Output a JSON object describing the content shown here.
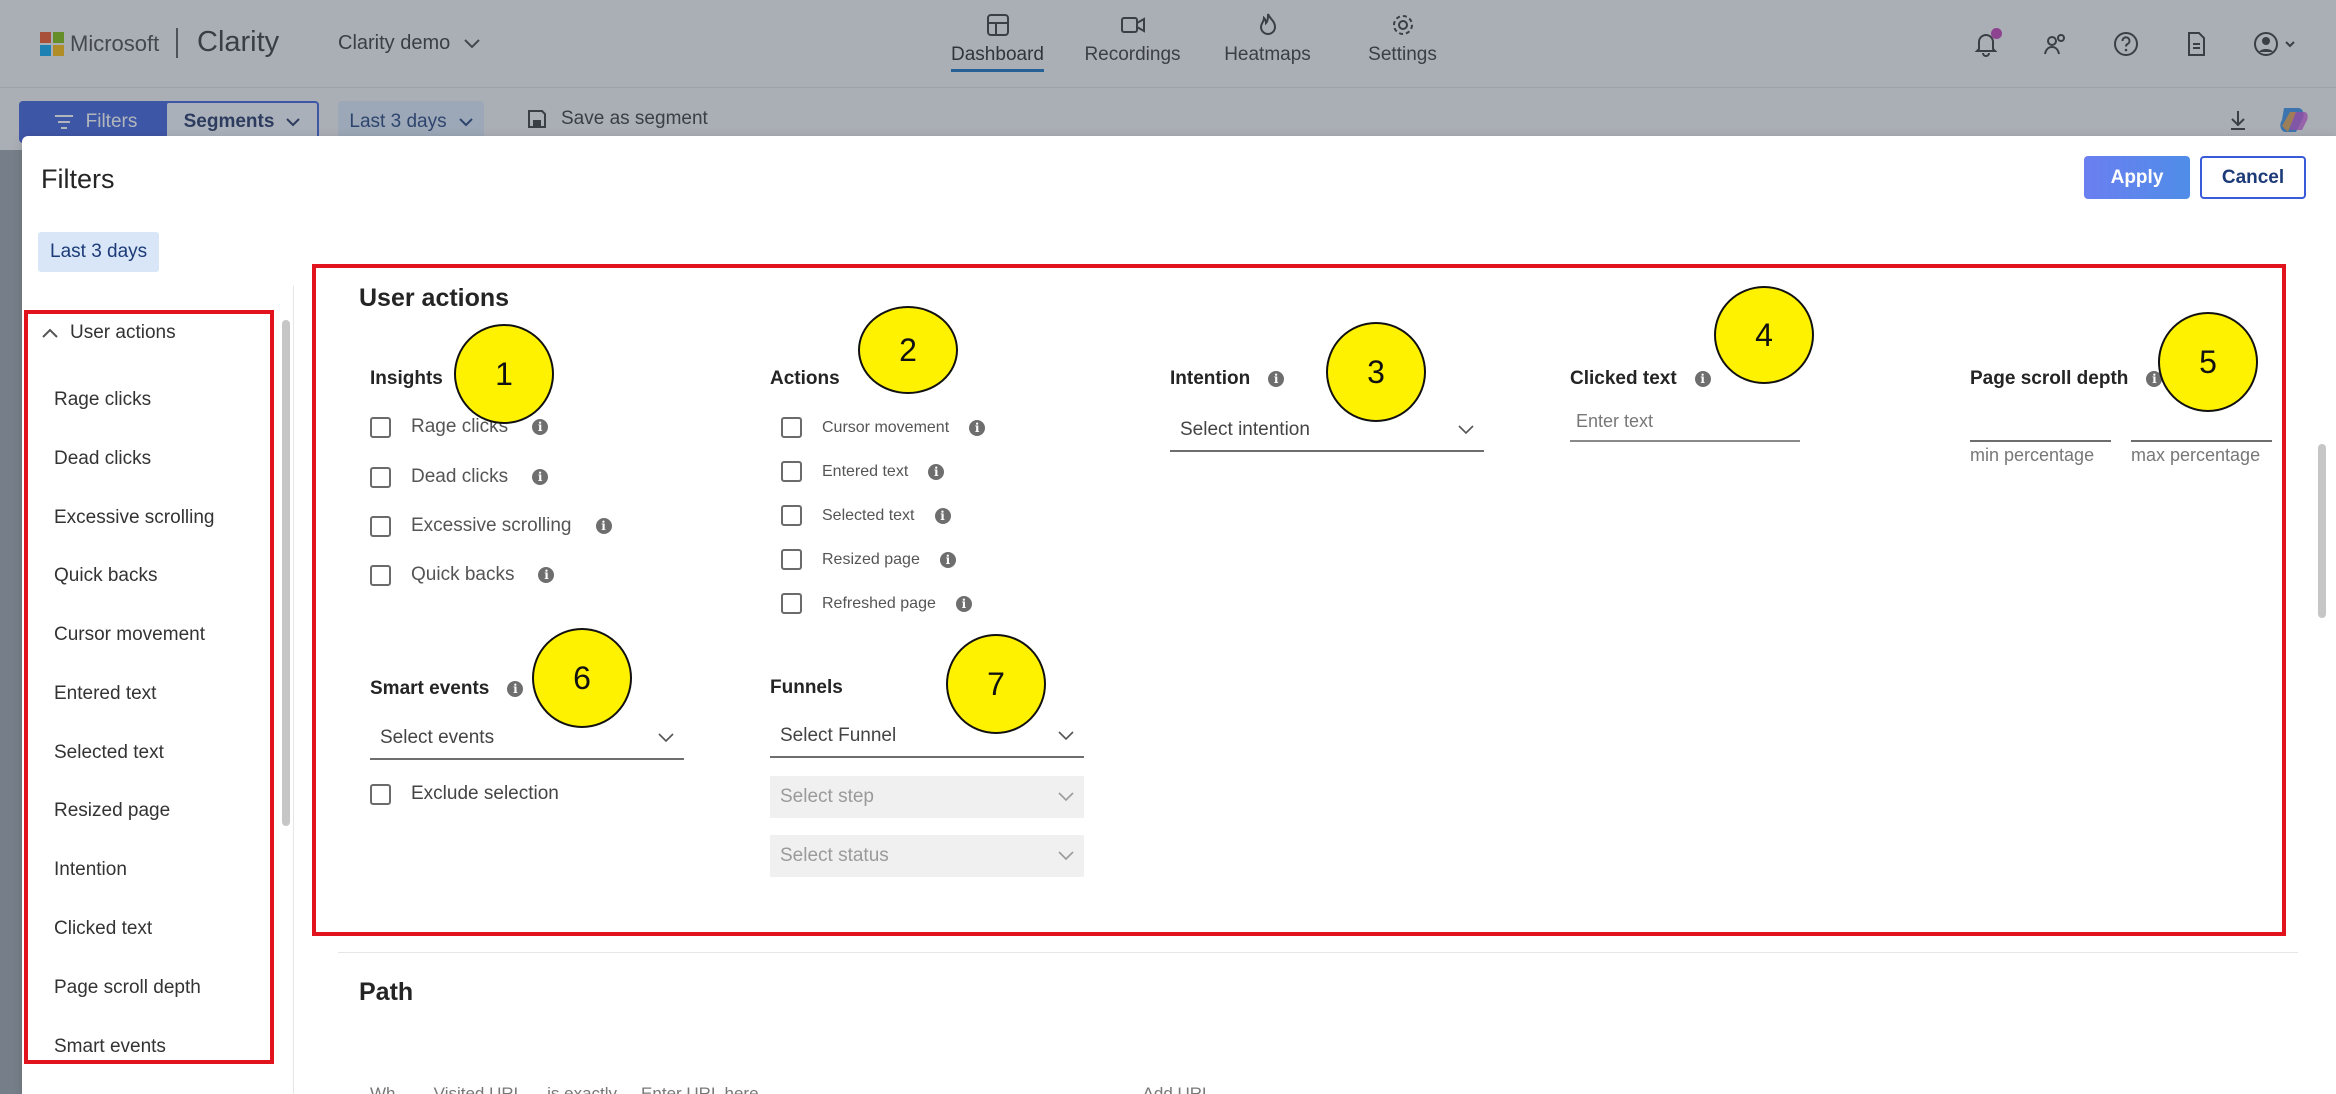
{
  "app": {
    "brand": "Microsoft",
    "name": "Clarity",
    "project": "Clarity demo",
    "nav": [
      {
        "label": "Dashboard",
        "icon": "dashboard-icon"
      },
      {
        "label": "Recordings",
        "icon": "video-icon"
      },
      {
        "label": "Heatmaps",
        "icon": "flame-icon"
      },
      {
        "label": "Settings",
        "icon": "gear-icon"
      }
    ],
    "active_nav": "Dashboard"
  },
  "toolbar": {
    "filters_label": "Filters",
    "segments_label": "Segments",
    "range_label": "Last 3 days",
    "save_label": "Save as segment"
  },
  "modal": {
    "title": "Filters",
    "apply_label": "Apply",
    "cancel_label": "Cancel",
    "chip": "Last 3 days",
    "nav_section": "User actions",
    "nav_items": [
      "Rage clicks",
      "Dead clicks",
      "Excessive scrolling",
      "Quick backs",
      "Cursor movement",
      "Entered text",
      "Selected text",
      "Resized page",
      "Intention",
      "Clicked text",
      "Page scroll depth",
      "Smart events"
    ]
  },
  "user_actions": {
    "title": "User actions",
    "insights": {
      "heading": "Insights",
      "items": [
        "Rage clicks",
        "Dead clicks",
        "Excessive scrolling",
        "Quick backs"
      ]
    },
    "actions": {
      "heading": "Actions",
      "items": [
        "Cursor movement",
        "Entered text",
        "Selected text",
        "Resized page",
        "Refreshed page"
      ]
    },
    "intention": {
      "heading": "Intention",
      "placeholder": "Select intention"
    },
    "clicked_text": {
      "heading": "Clicked text",
      "placeholder": "Enter text"
    },
    "scroll_depth": {
      "heading": "Page scroll depth",
      "min_hint": "min percentage",
      "max_hint": "max percentage"
    },
    "smart_events": {
      "heading": "Smart events",
      "placeholder": "Select events",
      "exclude_label": "Exclude selection"
    },
    "funnels": {
      "heading": "Funnels",
      "funnel_placeholder": "Select Funnel",
      "step_placeholder": "Select step",
      "status_placeholder": "Select status"
    }
  },
  "annotations": [
    "1",
    "2",
    "3",
    "4",
    "5",
    "6",
    "7"
  ],
  "path": {
    "title": "Path",
    "row_texts": [
      "Wh...",
      "Visited URL",
      "is exactly",
      "Enter URL here",
      "Add URL"
    ]
  },
  "colors": {
    "accent": "#3a5bd9",
    "highlight_box": "#e1131d",
    "badge": "#fff200",
    "notification": "#c239b3"
  }
}
